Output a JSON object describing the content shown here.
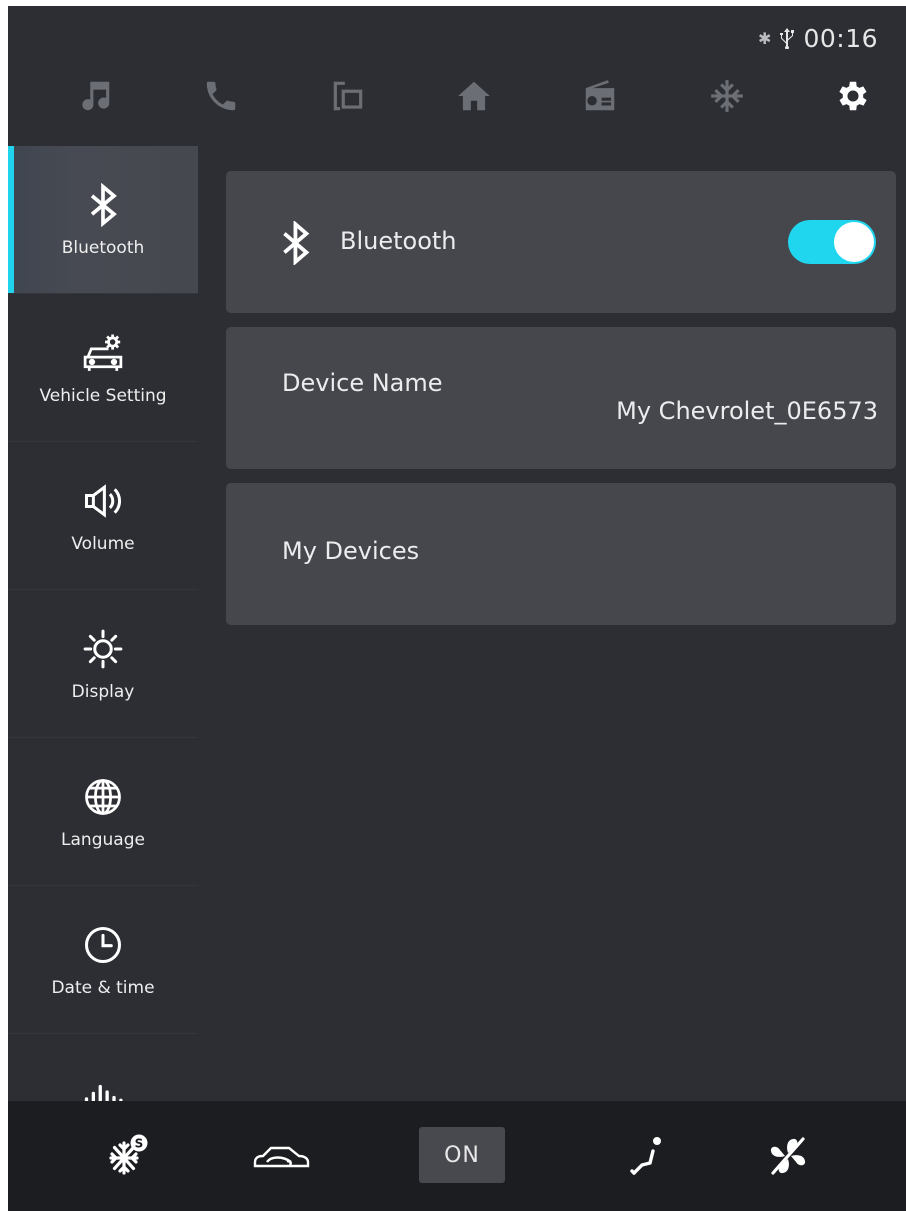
{
  "status_bar": {
    "time": "00:16",
    "icons": [
      "bluetooth-icon",
      "usb-icon"
    ]
  },
  "top_nav": {
    "items": [
      {
        "name": "music",
        "icon": "music-note-icon",
        "active": false
      },
      {
        "name": "phone",
        "icon": "phone-icon",
        "active": false
      },
      {
        "name": "projection",
        "icon": "phone-projection-icon",
        "active": false
      },
      {
        "name": "home",
        "icon": "home-icon",
        "active": false
      },
      {
        "name": "radio",
        "icon": "radio-icon",
        "active": false
      },
      {
        "name": "climate",
        "icon": "snowflake-icon",
        "active": false
      },
      {
        "name": "settings",
        "icon": "gear-icon",
        "active": true
      }
    ]
  },
  "sidebar": {
    "items": [
      {
        "label": "Bluetooth",
        "icon": "bluetooth-icon",
        "active": true
      },
      {
        "label": "Vehicle Setting",
        "icon": "car-settings-icon",
        "active": false
      },
      {
        "label": "Volume",
        "icon": "speaker-icon",
        "active": false
      },
      {
        "label": "Display",
        "icon": "brightness-icon",
        "active": false
      },
      {
        "label": "Language",
        "icon": "globe-icon",
        "active": false
      },
      {
        "label": "Date & time",
        "icon": "clock-icon",
        "active": false
      },
      {
        "label": "",
        "icon": "sound-wave-icon",
        "active": false
      }
    ]
  },
  "main": {
    "bluetooth": {
      "label": "Bluetooth",
      "enabled": true
    },
    "device_name": {
      "label": "Device Name",
      "value": "My Chevrolet_0E6573"
    },
    "my_devices": {
      "label": "My Devices"
    }
  },
  "bottom_bar": {
    "ac_badge": "S",
    "on_label": "ON",
    "icons": [
      "ac-snowflake-icon",
      "recirculation-icon",
      "seat-airflow-icon",
      "fan-off-icon"
    ]
  },
  "colors": {
    "accent": "#21d4ee",
    "background": "#2c2e34",
    "card": "#46474d",
    "bottom_bar": "#1c1d21"
  }
}
